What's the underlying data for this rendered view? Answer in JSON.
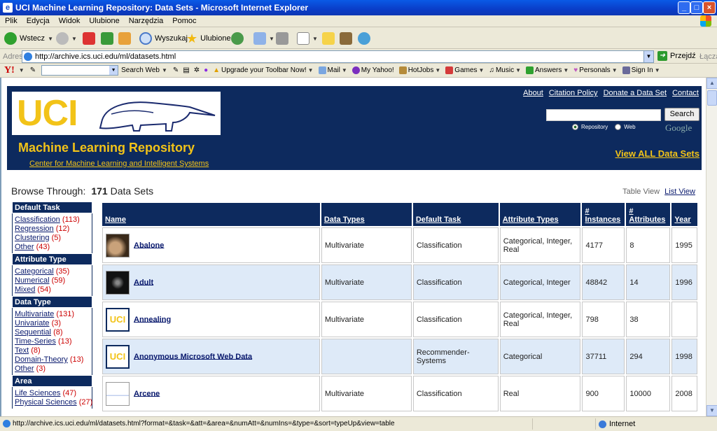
{
  "window": {
    "title": "UCI Machine Learning Repository: Data Sets - Microsoft Internet Explorer"
  },
  "menu": [
    "Plik",
    "Edycja",
    "Widok",
    "Ulubione",
    "Narzędzia",
    "Pomoc"
  ],
  "toolbar": {
    "back": "Wstecz",
    "search": "Wyszukaj",
    "favorites": "Ulubione"
  },
  "address": {
    "label": "Adres",
    "url": "http://archive.ics.uci.edu/ml/datasets.html",
    "go": "Przejdź",
    "links": "Łącza"
  },
  "yahoo": {
    "search_web": "Search Web",
    "items": [
      "Upgrade your Toolbar Now!",
      "Mail",
      "My Yahoo!",
      "HotJobs",
      "Games",
      "Music",
      "Answers",
      "Personals",
      "Sign In"
    ]
  },
  "header": {
    "logo_text": "UCI",
    "title": "Machine Learning Repository",
    "subtitle": "Center for Machine Learning and Intelligent Systems",
    "links": [
      "About",
      "Citation Policy",
      "Donate a Data Set",
      "Contact"
    ],
    "search_button": "Search",
    "radio_repository": "Repository",
    "radio_web": "Web",
    "google": "Google",
    "view_all": "View ALL Data Sets"
  },
  "browse": {
    "label": "Browse Through:",
    "count": "171",
    "count_suffix": "Data Sets",
    "table_view": "Table View",
    "list_view": "List View"
  },
  "sidebar": [
    {
      "title": "Default Task",
      "items": [
        {
          "label": "Classification",
          "count": "(113)"
        },
        {
          "label": "Regression",
          "count": "(12)"
        },
        {
          "label": "Clustering",
          "count": "(5)"
        },
        {
          "label": "Other",
          "count": "(43)"
        }
      ]
    },
    {
      "title": "Attribute Type",
      "items": [
        {
          "label": "Categorical",
          "count": "(35)"
        },
        {
          "label": "Numerical",
          "count": "(59)"
        },
        {
          "label": "Mixed",
          "count": "(54)"
        }
      ]
    },
    {
      "title": "Data Type",
      "items": [
        {
          "label": "Multivariate",
          "count": "(131)"
        },
        {
          "label": "Univariate",
          "count": "(3)"
        },
        {
          "label": "Sequential",
          "count": "(8)"
        },
        {
          "label": "Time-Series",
          "count": "(13)"
        },
        {
          "label": "Text",
          "count": "(8)"
        },
        {
          "label": "Domain-Theory",
          "count": "(13)"
        },
        {
          "label": "Other",
          "count": "(3)"
        }
      ]
    },
    {
      "title": "Area",
      "items": [
        {
          "label": "Life Sciences",
          "count": "(47)"
        },
        {
          "label": "Physical Sciences",
          "count": "(27)"
        }
      ]
    }
  ],
  "table": {
    "columns": [
      "Name",
      "Data Types",
      "Default Task",
      "Attribute Types",
      "# Instances",
      "# Attributes",
      "Year"
    ],
    "rows": [
      {
        "thumb": "photo",
        "name": "Abalone",
        "data_types": "Multivariate",
        "task": "Classification",
        "attr_types": "Categorical, Integer, Real",
        "instances": "4177",
        "attributes": "8",
        "year": "1995"
      },
      {
        "thumb": "photo",
        "name": "Adult",
        "data_types": "Multivariate",
        "task": "Classification",
        "attr_types": "Categorical, Integer",
        "instances": "48842",
        "attributes": "14",
        "year": "1996"
      },
      {
        "thumb": "uci",
        "name": "Annealing",
        "data_types": "Multivariate",
        "task": "Classification",
        "attr_types": "Categorical, Integer, Real",
        "instances": "798",
        "attributes": "38",
        "year": ""
      },
      {
        "thumb": "uci",
        "name": "Anonymous Microsoft Web Data",
        "data_types": "",
        "task": "Recommender-Systems",
        "attr_types": "Categorical",
        "instances": "37711",
        "attributes": "294",
        "year": "1998"
      },
      {
        "thumb": "plot",
        "name": "Arcene",
        "data_types": "Multivariate",
        "task": "Classification",
        "attr_types": "Real",
        "instances": "900",
        "attributes": "10000",
        "year": "2008"
      }
    ]
  },
  "status": {
    "url": "http://archive.ics.uci.edu/ml/datasets.html?format=&task=&att=&area=&numAtt=&numIns=&type=&sort=typeUp&view=table",
    "zone": "Internet"
  },
  "colors": {
    "navy": "#0d2a5e",
    "gold": "#f2c318",
    "row_alt": "#deeaf8"
  }
}
